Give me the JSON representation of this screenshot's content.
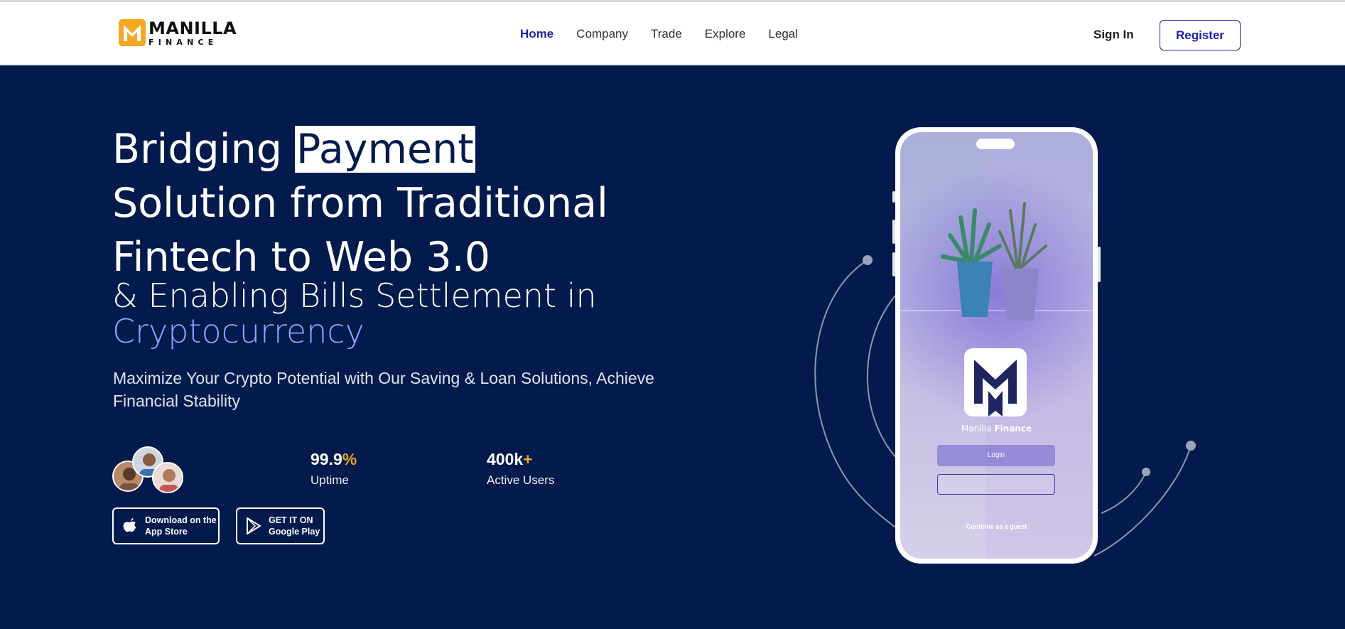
{
  "brand": {
    "name_line1": "MANILLA",
    "name_line2": "FINANCE",
    "accent": "#F5A623"
  },
  "nav": {
    "items": [
      {
        "label": "Home",
        "active": true
      },
      {
        "label": "Company",
        "active": false
      },
      {
        "label": "Trade",
        "active": false
      },
      {
        "label": "Explore",
        "active": false
      },
      {
        "label": "Legal",
        "active": false
      }
    ],
    "sign_in": "Sign In",
    "register": "Register"
  },
  "hero": {
    "title_part1": "Bridging ",
    "title_highlight": "Payment",
    "title_line2": "Solution from Traditional",
    "title_line3": "Fintech to Web 3.0",
    "subtitle_line1": "& Enabling Bills Settlement in",
    "subtitle_line2": "Cryptocurrency",
    "description": "Maximize Your Crypto Potential with Our Saving & Loan Solutions, Achieve Financial Stability",
    "stats": [
      {
        "value": "99.9",
        "suffix": "%",
        "label": "Uptime"
      },
      {
        "value": "400k",
        "suffix": "+",
        "label": "Active Users"
      }
    ],
    "app_store": {
      "line1": "Download on the",
      "line2": "App Store",
      "icon": "apple-icon"
    },
    "google_play": {
      "line1": "GET IT ON",
      "line2": "Google Play",
      "icon": "play-icon"
    }
  },
  "phone": {
    "brand_regular": "Manilla ",
    "brand_bold": "Finance",
    "login": "Login",
    "guest": "Continue as a guest"
  },
  "colors": {
    "hero_bg": "#021A4C",
    "primary": "#1B22A8",
    "highlight_text": "#8DA3FF"
  }
}
